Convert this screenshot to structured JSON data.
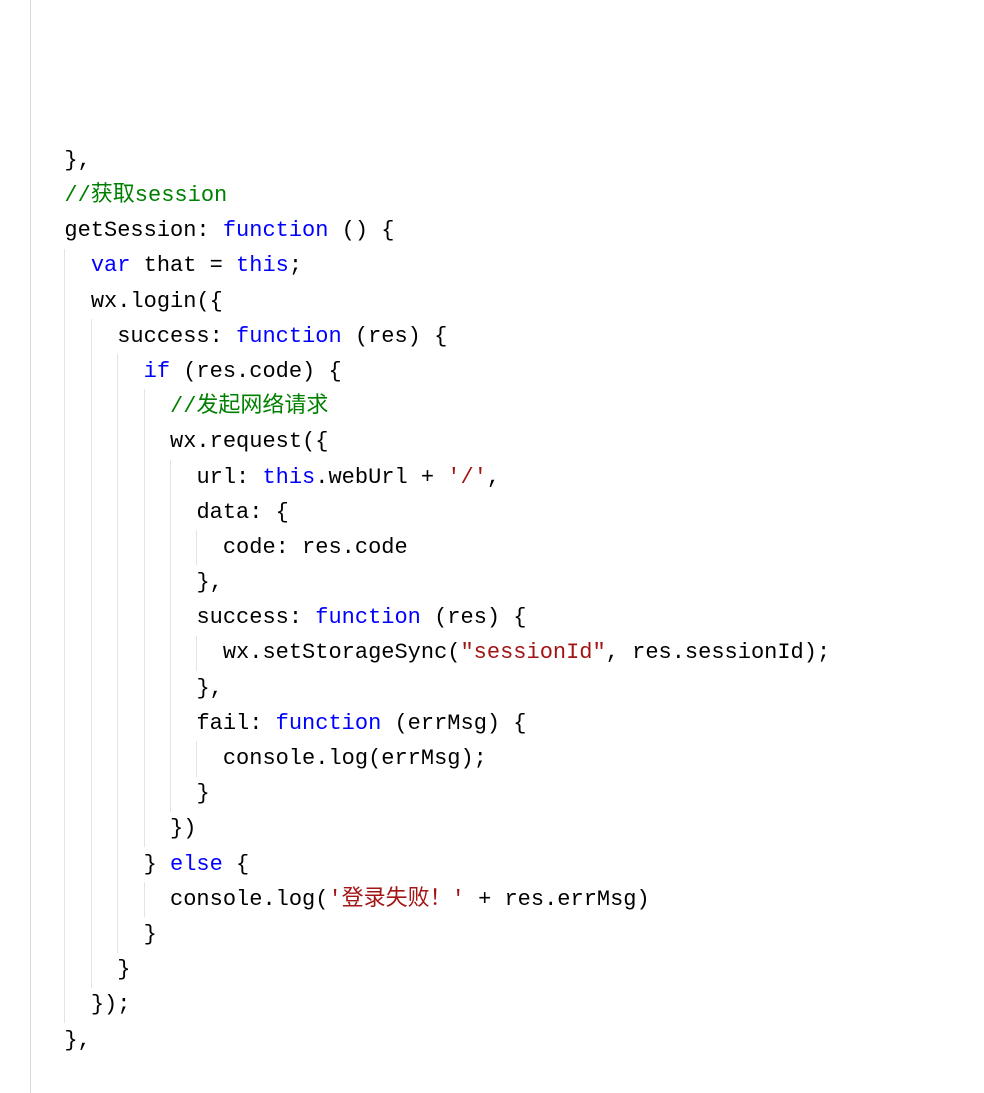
{
  "code": {
    "lines": [
      {
        "indent": 0,
        "tokens": [
          [
            "punct",
            "},"
          ]
        ]
      },
      {
        "indent": 0,
        "tokens": [
          [
            "comment",
            "//获取session"
          ]
        ]
      },
      {
        "indent": 0,
        "tokens": [
          [
            "ident",
            "getSession: "
          ],
          [
            "keyword",
            "function"
          ],
          [
            "ident",
            " () {"
          ]
        ]
      },
      {
        "indent": 1,
        "tokens": [
          [
            "keyword",
            "var"
          ],
          [
            "ident",
            " that = "
          ],
          [
            "keyword",
            "this"
          ],
          [
            "punct",
            ";"
          ]
        ]
      },
      {
        "indent": 1,
        "tokens": [
          [
            "ident",
            "wx.login({"
          ]
        ]
      },
      {
        "indent": 2,
        "tokens": [
          [
            "ident",
            "success: "
          ],
          [
            "keyword",
            "function"
          ],
          [
            "ident",
            " (res) {"
          ]
        ]
      },
      {
        "indent": 3,
        "tokens": [
          [
            "keyword",
            "if"
          ],
          [
            "ident",
            " (res.code) {"
          ]
        ]
      },
      {
        "indent": 4,
        "tokens": [
          [
            "comment",
            "//发起网络请求"
          ]
        ]
      },
      {
        "indent": 4,
        "tokens": [
          [
            "ident",
            "wx.request({"
          ]
        ]
      },
      {
        "indent": 5,
        "tokens": [
          [
            "ident",
            "url: "
          ],
          [
            "keyword",
            "this"
          ],
          [
            "ident",
            ".webUrl + "
          ],
          [
            "string",
            "'/'"
          ],
          [
            "punct",
            ","
          ]
        ]
      },
      {
        "indent": 5,
        "tokens": [
          [
            "ident",
            "data: {"
          ]
        ]
      },
      {
        "indent": 6,
        "tokens": [
          [
            "ident",
            "code: res.code"
          ]
        ]
      },
      {
        "indent": 5,
        "tokens": [
          [
            "punct",
            "},"
          ]
        ]
      },
      {
        "indent": 5,
        "tokens": [
          [
            "ident",
            "success: "
          ],
          [
            "keyword",
            "function"
          ],
          [
            "ident",
            " (res) {"
          ]
        ]
      },
      {
        "indent": 6,
        "tokens": [
          [
            "ident",
            "wx.setStorageSync("
          ],
          [
            "string",
            "\"sessionId\""
          ],
          [
            "ident",
            ", res.sessionId);"
          ]
        ]
      },
      {
        "indent": 5,
        "tokens": [
          [
            "punct",
            "},"
          ]
        ]
      },
      {
        "indent": 5,
        "tokens": [
          [
            "ident",
            "fail: "
          ],
          [
            "keyword",
            "function"
          ],
          [
            "ident",
            " (errMsg) {"
          ]
        ]
      },
      {
        "indent": 6,
        "tokens": [
          [
            "ident",
            "console.log(errMsg);"
          ]
        ]
      },
      {
        "indent": 5,
        "tokens": [
          [
            "punct",
            "}"
          ]
        ]
      },
      {
        "indent": 4,
        "tokens": [
          [
            "punct",
            "})"
          ]
        ]
      },
      {
        "indent": 3,
        "tokens": [
          [
            "punct",
            "} "
          ],
          [
            "keyword",
            "else"
          ],
          [
            "punct",
            " {"
          ]
        ]
      },
      {
        "indent": 4,
        "tokens": [
          [
            "ident",
            "console.log("
          ],
          [
            "string",
            "'登录失败！'"
          ],
          [
            "ident",
            " + res.errMsg)"
          ]
        ]
      },
      {
        "indent": 3,
        "tokens": [
          [
            "punct",
            "}"
          ]
        ]
      },
      {
        "indent": 2,
        "tokens": [
          [
            "punct",
            "}"
          ]
        ]
      },
      {
        "indent": 1,
        "tokens": [
          [
            "punct",
            "});"
          ]
        ]
      },
      {
        "indent": 0,
        "tokens": [
          [
            "punct",
            "},"
          ]
        ]
      }
    ],
    "indent_unit": "  ",
    "base_indent": "  ",
    "colors": {
      "comment": "#008000",
      "keyword": "#0000ff",
      "string": "#a31515",
      "default": "#000000",
      "guide": "#e3e3e3",
      "gutter": "#d9d9d9"
    },
    "font_px": 22,
    "line_height_px": 35.2,
    "guide_levels": [
      0,
      1,
      2,
      3,
      4,
      5,
      6
    ]
  }
}
